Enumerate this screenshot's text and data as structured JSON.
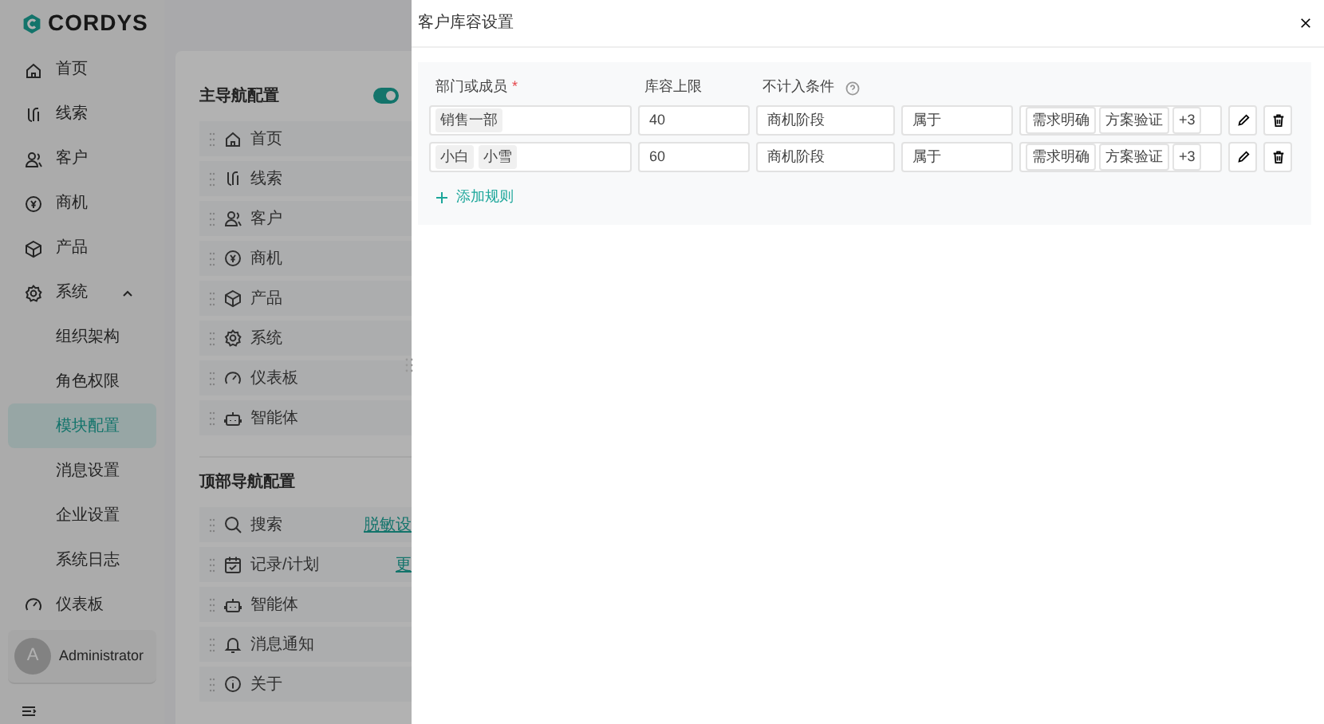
{
  "sidebar": {
    "logo": "CORDYS",
    "items": [
      {
        "label": "首页"
      },
      {
        "label": "线索"
      },
      {
        "label": "客户"
      },
      {
        "label": "商机"
      },
      {
        "label": "产品"
      },
      {
        "label": "系统",
        "expanded": true,
        "children": [
          {
            "label": "组织架构",
            "selected": false
          },
          {
            "label": "角色权限",
            "selected": false
          },
          {
            "label": "模块配置",
            "selected": true
          },
          {
            "label": "消息设置",
            "selected": false
          },
          {
            "label": "企业设置",
            "selected": false
          },
          {
            "label": "系统日志",
            "selected": false
          }
        ]
      },
      {
        "label": "仪表板"
      }
    ],
    "user": {
      "avatar": "A",
      "name": "Administrator"
    }
  },
  "module_config": {
    "sections": [
      {
        "title": "主导航配置",
        "toggle_on": true,
        "items": [
          {
            "label": "首页"
          },
          {
            "label": "线索"
          },
          {
            "label": "客户"
          },
          {
            "label": "商机"
          },
          {
            "label": "产品"
          },
          {
            "label": "系统"
          },
          {
            "label": "仪表板"
          },
          {
            "label": "智能体"
          }
        ]
      },
      {
        "title": "顶部导航配置",
        "items": [
          {
            "label": "搜索",
            "link": "脱敏设"
          },
          {
            "label": "记录/计划",
            "link": "更"
          },
          {
            "label": "智能体"
          },
          {
            "label": "消息通知"
          },
          {
            "label": "关于"
          }
        ]
      }
    ]
  },
  "drawer": {
    "title": "客户库容设置",
    "columns": [
      {
        "label": "部门或成员",
        "required_mark": "*"
      },
      {
        "label": "库容上限"
      },
      {
        "label": "不计入条件",
        "help": true
      }
    ],
    "rules": [
      {
        "members": [
          "销售一部"
        ],
        "limit": "40",
        "field": "商机阶段",
        "operator": "属于",
        "values": [
          "需求明确",
          "方案验证"
        ],
        "more": "+3"
      },
      {
        "members": [
          "小白",
          "小雪"
        ],
        "limit": "60",
        "field": "商机阶段",
        "operator": "属于",
        "values": [
          "需求明确",
          "方案验证"
        ],
        "more": "+3"
      }
    ],
    "add_button": "添加规则"
  }
}
